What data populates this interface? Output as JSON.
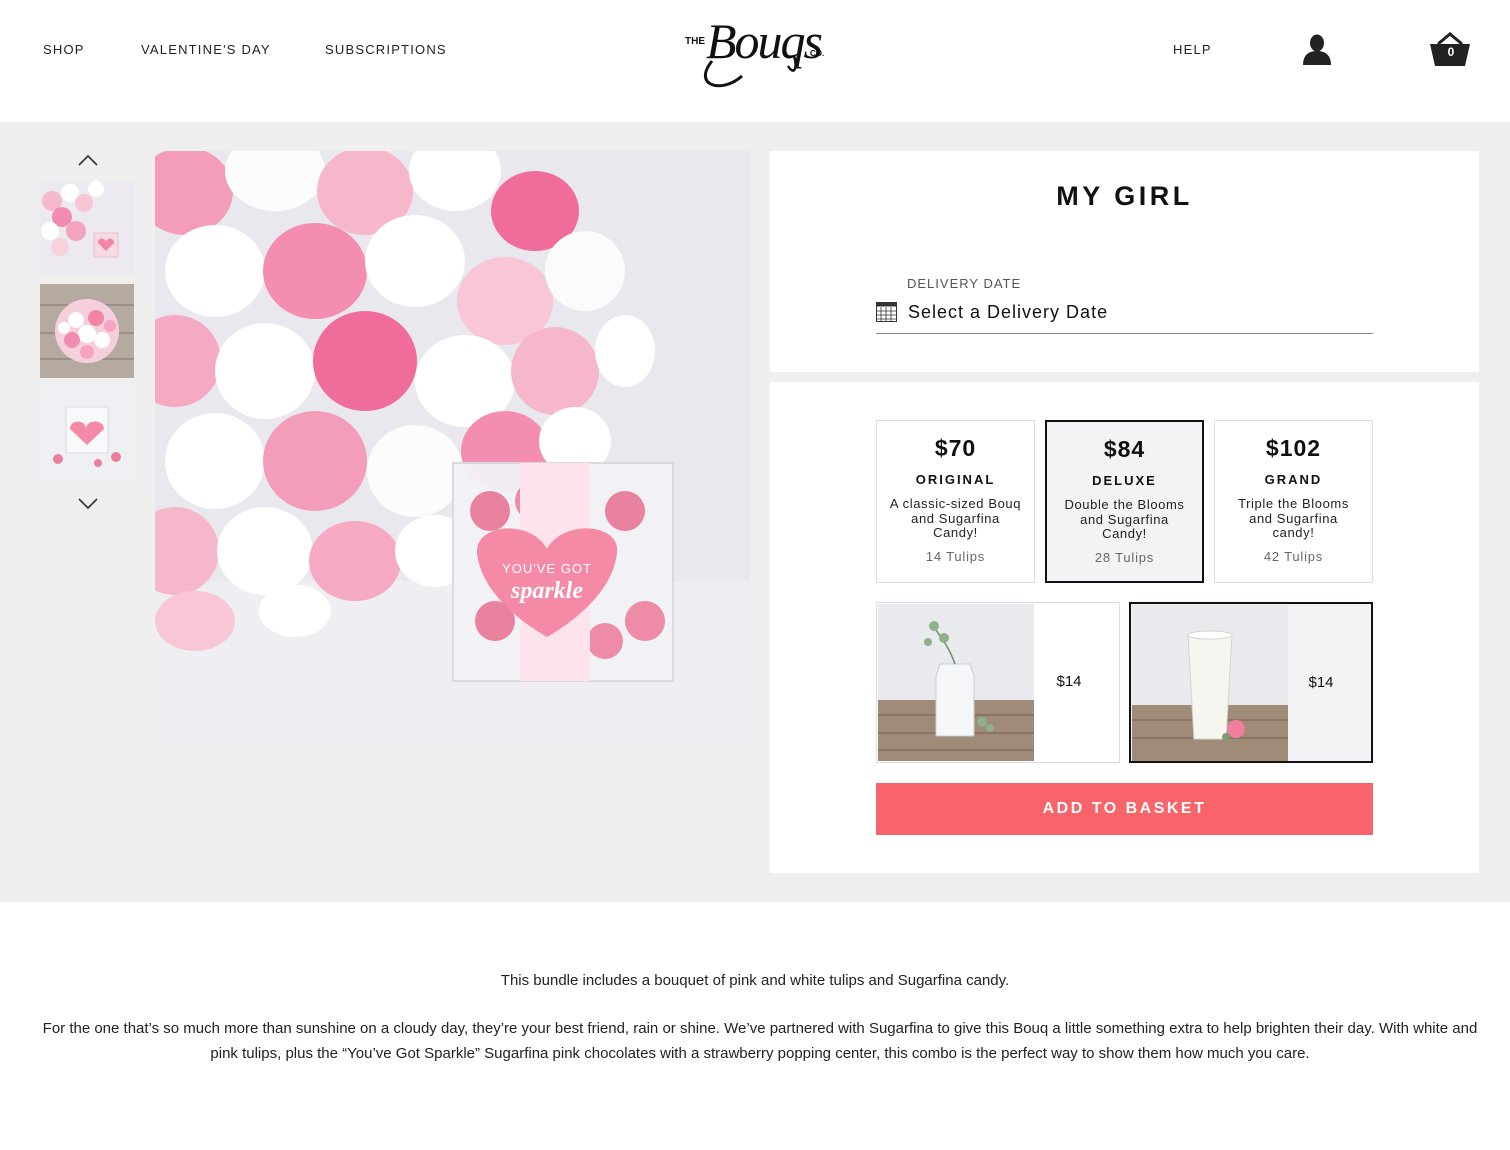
{
  "header": {
    "nav": [
      "SHOP",
      "VALENTINE'S DAY",
      "SUBSCRIPTIONS"
    ],
    "help": "HELP",
    "logo": {
      "the": "THE",
      "name": "Bouqs",
      "co": "CO."
    },
    "cart_count": "0"
  },
  "gallery": {
    "thumbnails": [
      "tulips-and-candy-thumb",
      "tulip-bouquet-top-thumb",
      "sugarfina-candy-thumb"
    ],
    "main_image": "pink-white-tulips-with-sugarfina",
    "candy_label": [
      "YOU'VE GOT",
      "sparkle"
    ]
  },
  "product": {
    "title": "MY GIRL",
    "delivery_label": "DELIVERY DATE",
    "delivery_placeholder": "Select a Delivery Date",
    "options": [
      {
        "price": "$70",
        "name": "ORIGINAL",
        "desc": "A classic-sized Bouq and Sugarfina Candy!",
        "stems": "14 Tulips",
        "selected": false
      },
      {
        "price": "$84",
        "name": "DELUXE",
        "desc": "Double the Blooms and Sugarfina Candy!",
        "stems": "28 Tulips",
        "selected": true
      },
      {
        "price": "$102",
        "name": "GRAND",
        "desc": "Triple the Blooms and Sugarfina candy!",
        "stems": "42 Tulips",
        "selected": false
      }
    ],
    "vases": [
      {
        "image": "glass-jar-vase",
        "price": "$14",
        "selected": false
      },
      {
        "image": "white-ceramic-vase",
        "price": "$14",
        "selected": true
      }
    ],
    "add_button": "ADD TO BASKET"
  },
  "description": {
    "summary": "This bundle includes a bouquet of pink and white tulips and Sugarfina candy.",
    "body": "For the one that’s so much more than sunshine on a cloudy day, they’re your best friend, rain or shine. We’ve partnered with Sugarfina to give this Bouq a little something extra to help brighten their day. With white and pink tulips, plus the “You’ve Got Sparkle” Sugarfina pink chocolates with a strawberry popping center, this combo is the perfect way to show them how much you care."
  },
  "colors": {
    "accent": "#f9646b",
    "band": "#efefef",
    "selected_bg": "#f2f3f5"
  }
}
